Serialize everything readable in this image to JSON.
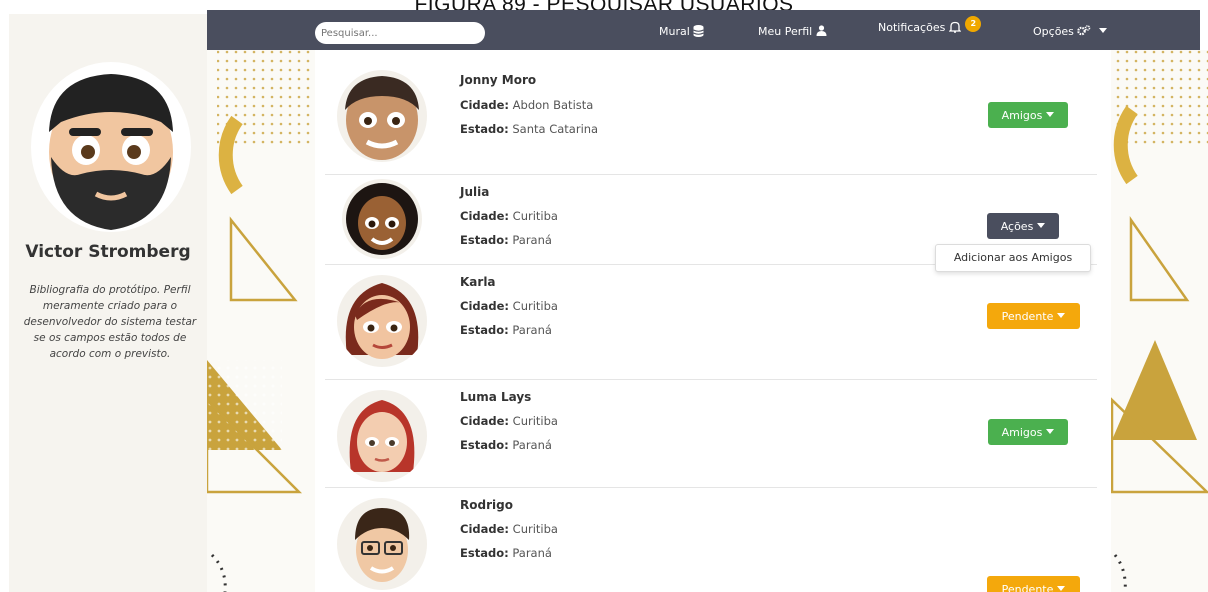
{
  "caption": "FIGURA 89 - PESQUISAR USUÁRIOS",
  "navbar": {
    "search_placeholder": "Pesquisar...",
    "mural": "Mural",
    "meu_perfil": "Meu Perfil",
    "notificacoes": "Notificações",
    "notification_count": "2",
    "opcoes": "Opções"
  },
  "profile": {
    "name": "Victor Stromberg",
    "bio": "Bibliografia do protótipo. Perfil meramente criado para o desenvolvedor do sistema testar se os campos estão todos de acordo com o previsto."
  },
  "city_label": "Cidade:",
  "state_label": "Estado:",
  "users": [
    {
      "name": "Jonny Moro",
      "city": "Abdon Batista",
      "state": "Santa Catarina",
      "action": "Amigos",
      "status": "green"
    },
    {
      "name": "Julia",
      "city": "Curitiba",
      "state": "Paraná",
      "action": "Ações",
      "status": "dark"
    },
    {
      "name": "Karla",
      "city": "Curitiba",
      "state": "Paraná",
      "action": "Pendente",
      "status": "orange"
    },
    {
      "name": "Luma Lays",
      "city": "Curitiba",
      "state": "Paraná",
      "action": "Amigos",
      "status": "green"
    },
    {
      "name": "Rodrigo",
      "city": "Curitiba",
      "state": "Paraná",
      "action": "Pendente",
      "status": "orange"
    }
  ],
  "dropdown": {
    "item": "Adicionar aos Amigos"
  },
  "colors": {
    "navbar": "#4a4e5e",
    "green": "#4bb04f",
    "orange": "#f4a80c",
    "gold": "#c9a33d"
  }
}
